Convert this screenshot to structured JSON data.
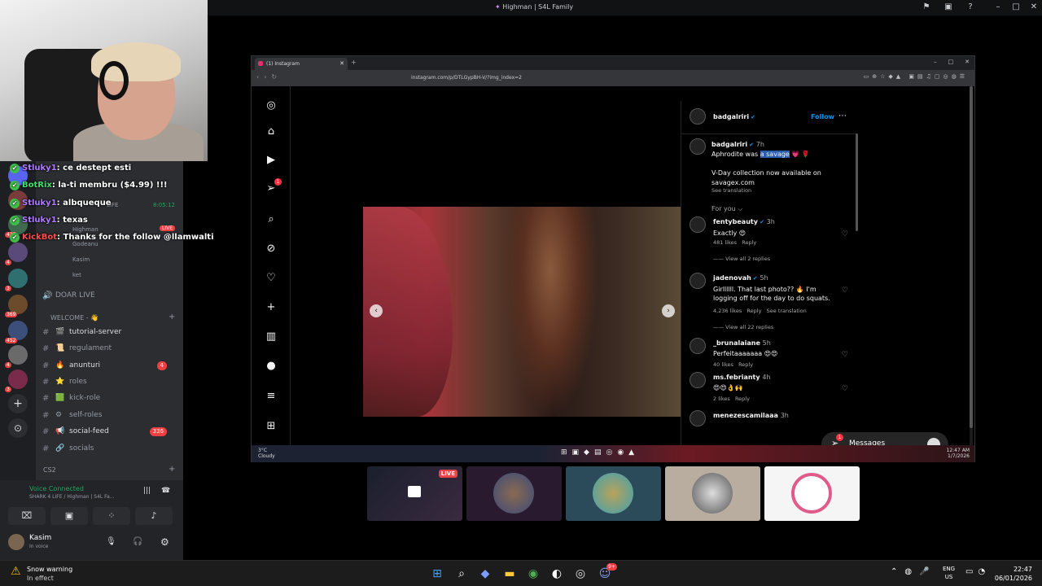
{
  "window": {
    "title": "Highman | S4L Family"
  },
  "chat": [
    {
      "user": "Stluky1",
      "text": ": ce destept esti",
      "cls": "u1"
    },
    {
      "user": "BotRix",
      "text": ": la-ti membru ($4.99) !!!",
      "cls": "u2"
    },
    {
      "user": "Stluky1",
      "text": ": albquequе",
      "cls": "u1"
    },
    {
      "user": "Stluky1",
      "text": ": texas",
      "cls": "u1"
    },
    {
      "user": "KickBot",
      "text": ": Thanks for the follow @llamwalti",
      "cls": "u3"
    }
  ],
  "discord": {
    "stream_time": "8:05:12",
    "stream_label": "LIFE",
    "live_badge": "LIVE",
    "members": [
      "Highman",
      "Godeanu",
      "Kasim",
      "ket"
    ],
    "voice_channel": "DOAR LIVE",
    "category_welcome": "WELCOME - 👋",
    "category_cs2": "CS2",
    "channels": [
      {
        "name": "tutorial-server",
        "emoji": "🎬",
        "bright": true
      },
      {
        "name": "regulament",
        "emoji": "📜",
        "bright": false
      },
      {
        "name": "anunturi",
        "emoji": "🔥",
        "bright": true,
        "count": "4"
      },
      {
        "name": "roles",
        "emoji": "⭐",
        "bright": false
      },
      {
        "name": "kick-role",
        "emoji": "🟩",
        "bright": false
      },
      {
        "name": "self-roles",
        "emoji": "⚙",
        "bright": false
      },
      {
        "name": "social-feed",
        "emoji": "📢",
        "bright": true,
        "count": "336"
      },
      {
        "name": "socials",
        "emoji": "🔗",
        "bright": false
      }
    ],
    "server_badges": [
      "420",
      "4",
      "3",
      "369",
      "452",
      "4",
      "3"
    ],
    "voice": {
      "status": "Voice Connected",
      "sub": "SHARK 4 LIFE / Highman | S4L Fa...",
      "user": "Kasim",
      "user_status": "In voice"
    }
  },
  "browser": {
    "tab_title": "(1) Instagram",
    "url": "instagram.com/p/DTLGypBH-V/?img_index=2",
    "notif_count": "1"
  },
  "post": {
    "author": "badgalriri",
    "follow": "Follow",
    "time": "7h",
    "caption_pre": "Aphrodite was ",
    "caption_sel": "a savage",
    "caption_post": " 💗 🌹",
    "line2": "V-Day collection now available on",
    "line3": "savagex.com",
    "see_translation": "See translation",
    "for_you": "For you ⌵",
    "comments": [
      {
        "user": "fentybeauty",
        "time": "3h",
        "text": "Exactly 😍",
        "likes": "481 likes",
        "reply": "Reply",
        "view": "View all 2 replies"
      },
      {
        "user": "jadenovah",
        "time": "5h",
        "text": "Girllllll. That last photo?? 🔥 I'm logging off for the day to do squats.",
        "likes": "4,236 likes",
        "reply": "Reply",
        "extra": "See translation",
        "view": "View all 22 replies"
      },
      {
        "user": "_brunalaiane",
        "time": "5h",
        "text": "Perfeitaaaaaaa 😍😍",
        "likes": "40 likes",
        "reply": "Reply"
      },
      {
        "user": "ms.febrianty",
        "time": "4h",
        "text": "😍😍👌🙌",
        "likes": "2 likes",
        "reply": "Reply"
      },
      {
        "user": "menezescamilaaa",
        "time": "3h",
        "text": "",
        "likes": "",
        "reply": ""
      }
    ],
    "messages_label": "Messages",
    "messages_badge": "1"
  },
  "inner_taskbar": {
    "weather_temp": "3°C",
    "weather_desc": "Cloudy",
    "time": "12:47 AM",
    "date": "1/7/2026"
  },
  "thumbs": {
    "live": "LIVE"
  },
  "taskbar": {
    "weather_title": "Snow warning",
    "weather_sub": "In effect",
    "lang1": "ENG",
    "lang2": "US",
    "time": "22:47",
    "date": "06/01/2026",
    "discord_badge": "9+"
  }
}
